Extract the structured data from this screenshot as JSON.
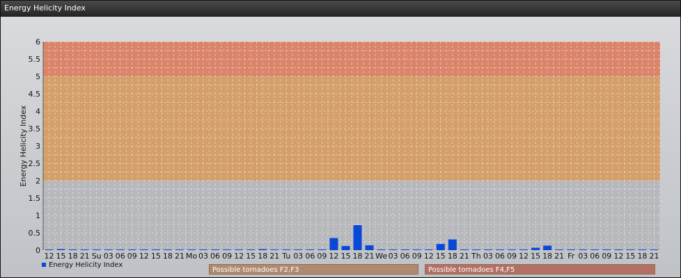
{
  "window": {
    "title": "Energy Helicity Index"
  },
  "legend": {
    "series_label": "Energy Helicity Index",
    "color": "#0a48d8"
  },
  "zones": {
    "f23_label": "Possible tornadoes F2,F3",
    "f45_label": "Possible tornadoes F4,F5",
    "bands": [
      {
        "from": 2,
        "to": 5,
        "color": "#d99a5a"
      },
      {
        "from": 5,
        "to": 6,
        "color": "#e07a5c"
      }
    ]
  },
  "chart_data": {
    "type": "bar",
    "ylabel": "Energy Helicity Index",
    "ylim": [
      0,
      6
    ],
    "yticks": [
      "0",
      "0.5",
      "1",
      "1.5",
      "2",
      "2.5",
      "3",
      "3.5",
      "4",
      "4.5",
      "5",
      "5.5",
      "6"
    ],
    "grid": true,
    "categories": [
      "12",
      "15",
      "18",
      "21",
      "Su",
      "03",
      "06",
      "09",
      "12",
      "15",
      "18",
      "21",
      "Mo",
      "03",
      "06",
      "09",
      "12",
      "15",
      "18",
      "21",
      "Tu",
      "03",
      "06",
      "09",
      "12",
      "15",
      "18",
      "21",
      "We",
      "03",
      "06",
      "09",
      "12",
      "15",
      "18",
      "21",
      "Th",
      "03",
      "06",
      "09",
      "12",
      "15",
      "18",
      "21",
      "Fr",
      "03",
      "06",
      "09",
      "12",
      "15",
      "18",
      "21"
    ],
    "series": [
      {
        "name": "Energy Helicity Index",
        "values": [
          0.01,
          0.03,
          0.01,
          0.01,
          0.01,
          0.01,
          0.01,
          0.01,
          0.01,
          0.01,
          0.01,
          0.01,
          0.01,
          0.01,
          0.01,
          0.01,
          0.01,
          0.01,
          0.03,
          0.02,
          0.01,
          0.01,
          0.01,
          0.01,
          0.35,
          0.12,
          0.72,
          0.14,
          0.01,
          0.01,
          0.01,
          0.01,
          0.01,
          0.18,
          0.31,
          0.02,
          0.01,
          0.01,
          0.01,
          0.01,
          0.01,
          0.07,
          0.13,
          0.01,
          0.01,
          0.01,
          0.01,
          0.01,
          0.01,
          0.01,
          0.01,
          0.01
        ]
      }
    ]
  }
}
